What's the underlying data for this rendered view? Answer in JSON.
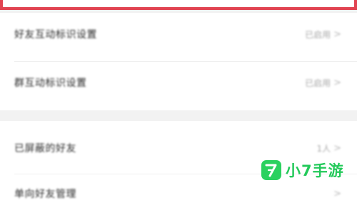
{
  "settings": {
    "group1": [
      {
        "label": "好友互动标识设置",
        "value": "已启用"
      },
      {
        "label": "群互动标识设置",
        "value": "已启用"
      }
    ],
    "group2": [
      {
        "label": "已屏蔽的好友",
        "value": "1人"
      },
      {
        "label": "单向好友管理",
        "value": ""
      }
    ],
    "chevron": ">"
  },
  "watermark": {
    "brand": "小7手游",
    "logo_color": "#2bd15f",
    "logo_icon": "number-7-icon"
  },
  "colors": {
    "highlight_frame": "#e14452",
    "background": "#f2f2f2"
  }
}
